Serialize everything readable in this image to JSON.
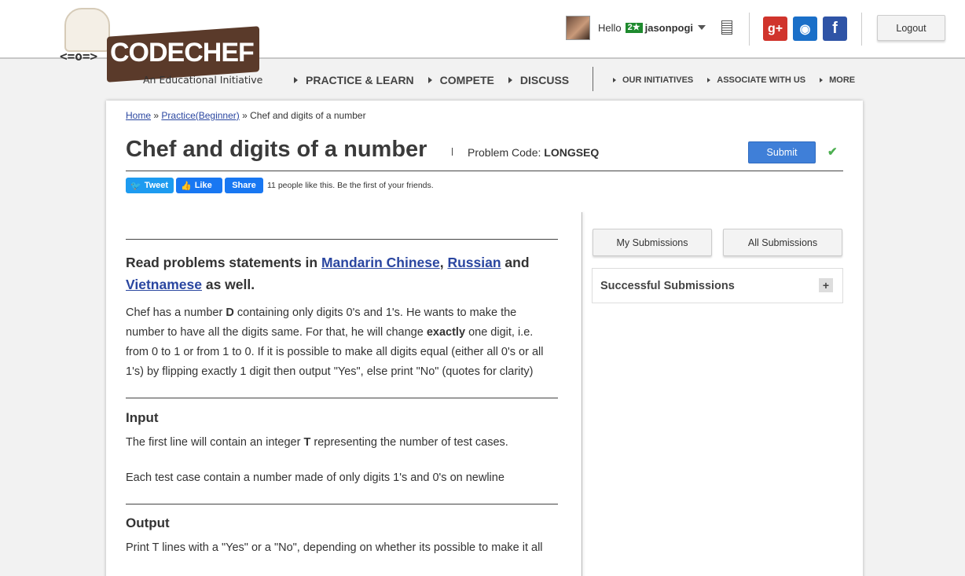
{
  "header": {
    "logo_text": "CODECHEF",
    "logo_face": "<=o=>",
    "logo_tagline": "An Educational Initiative",
    "greeting": "Hello",
    "user_rating": "2★",
    "username": "jasonpogi",
    "social": {
      "gplus": "g+",
      "github": "◉",
      "facebook": "f"
    },
    "logout_label": "Logout"
  },
  "nav": {
    "main": [
      "PRACTICE & LEARN",
      "COMPETE",
      "DISCUSS"
    ],
    "secondary": [
      "OUR INITIATIVES",
      "ASSOCIATE WITH US",
      "MORE"
    ]
  },
  "breadcrumb": {
    "home": "Home",
    "sep": "»",
    "practice": "Practice(Beginner)",
    "current": "Chef and digits of a number"
  },
  "problem": {
    "title": "Chef and digits of a number",
    "code_label": "Problem Code:",
    "code": "LONGSEQ",
    "submit_label": "Submit",
    "solved_mark": "✔"
  },
  "share": {
    "tweet": "Tweet",
    "like": "Like",
    "share": "Share",
    "like_text": "11 people like this. Be the first of your friends."
  },
  "statement": {
    "lang_prefix": "Read problems statements in",
    "lang1": "Mandarin Chinese",
    "comma": ",",
    "lang2": "Russian",
    "and": "and",
    "lang3": "Vietnamese",
    "lang_suffix": "as well.",
    "p1_a": "Chef has a number",
    "p1_d": "D",
    "p1_b": "containing only digits 0's and 1's. He wants to make the number to have all the digits same. For that, he will change",
    "p1_exactly": "exactly",
    "p1_c": "one digit, i.e. from 0 to 1 or from 1 to 0. If it is possible to make all digits equal (either all 0's or all 1's) by flipping exactly 1 digit then output \"Yes\", else print \"No\" (quotes for clarity)",
    "input_heading": "Input",
    "input_a": "The first line will contain an integer",
    "input_t": "T",
    "input_b": "representing the number of test cases.",
    "input_2": "Each test case contain a number made of only digits 1's and 0's on newline",
    "output_heading": "Output",
    "output_1": "Print T lines with a \"Yes\" or a \"No\", depending on whether its possible to make it all"
  },
  "sidebar": {
    "my_submissions": "My Submissions",
    "all_submissions": "All Submissions",
    "successful_label": "Successful Submissions",
    "expand": "+"
  }
}
